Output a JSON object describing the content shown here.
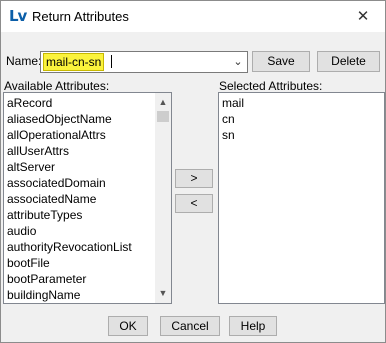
{
  "window": {
    "title": "Return Attributes",
    "logo_text": "Lv",
    "close_glyph": "✕"
  },
  "name_field": {
    "label": "Name:",
    "value": "mail-cn-sn",
    "dropdown_icon": "chevron-down-icon",
    "highlight_color": "#fbf33c"
  },
  "buttons": {
    "save": "Save",
    "delete": "Delete",
    "add": ">",
    "remove": "<",
    "ok": "OK",
    "cancel": "Cancel",
    "help": "Help"
  },
  "available": {
    "label": "Available Attributes:",
    "items": [
      "aRecord",
      "aliasedObjectName",
      "allOperationalAttrs",
      "allUserAttrs",
      "altServer",
      "associatedDomain",
      "associatedName",
      "attributeTypes",
      "audio",
      "authorityRevocationList",
      "bootFile",
      "bootParameter",
      "buildingName"
    ]
  },
  "selected": {
    "label": "Selected Attributes:",
    "items": [
      "mail",
      "cn",
      "sn"
    ]
  }
}
